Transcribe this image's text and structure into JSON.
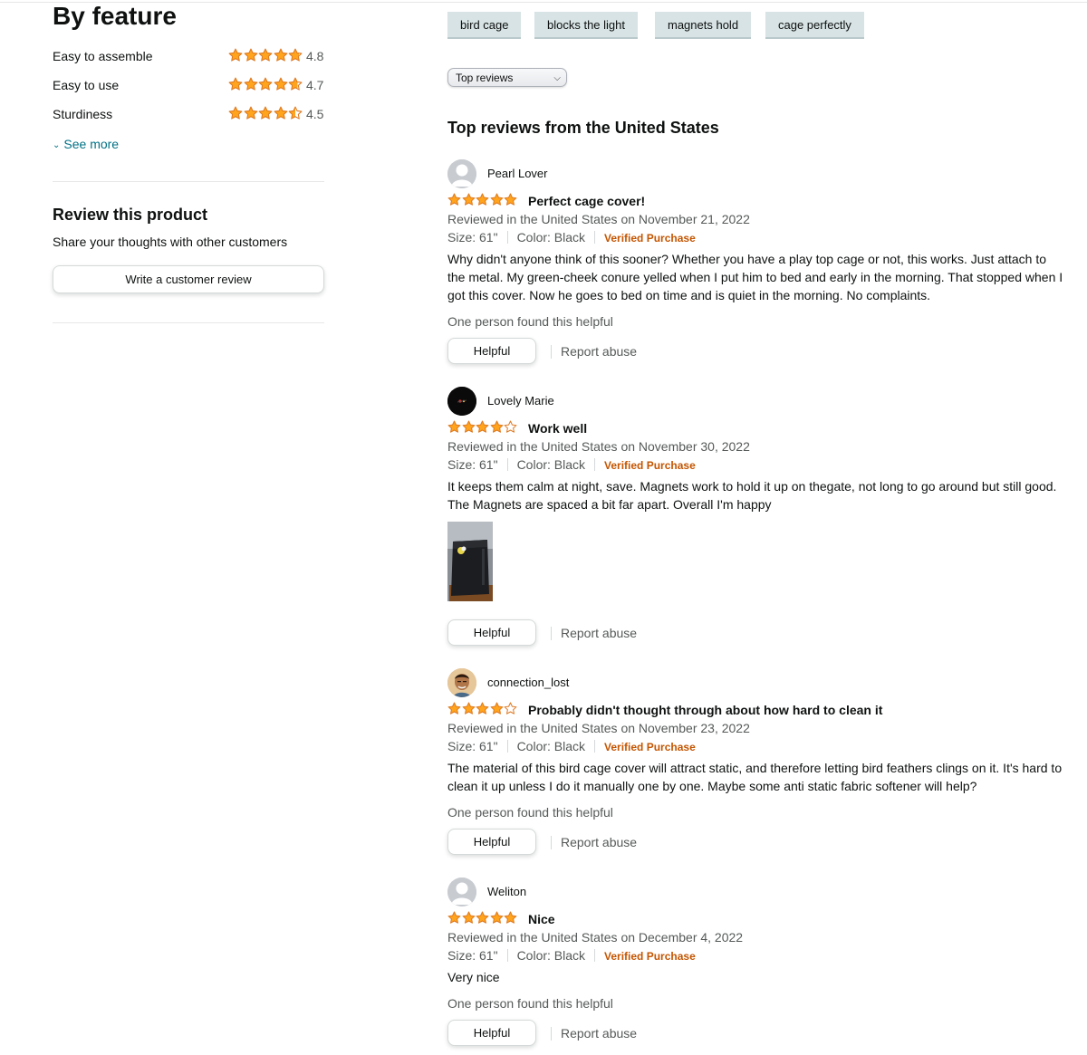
{
  "colors": {
    "star": "#ffa41c",
    "star_outline": "#de7921",
    "link": "#007185",
    "verified": "#c45500",
    "tag_bg": "#d7e3e4",
    "muted": "#565959"
  },
  "by_feature": {
    "title": "By feature",
    "items": [
      {
        "label": "Easy to assemble",
        "rating": 4.8,
        "rating_text": "4.8"
      },
      {
        "label": "Easy to use",
        "rating": 4.7,
        "rating_text": "4.7"
      },
      {
        "label": "Sturdiness",
        "rating": 4.5,
        "rating_text": "4.5"
      }
    ],
    "see_more": "See more"
  },
  "review_product": {
    "title": "Review this product",
    "subtitle": "Share your thoughts with other customers",
    "button": "Write a customer review"
  },
  "tags": [
    "bird cage",
    "blocks the light",
    "magnets hold",
    "cage perfectly"
  ],
  "sort": {
    "selected": "Top reviews"
  },
  "section_title": "Top reviews from the United States",
  "reviews": [
    {
      "name": "Pearl Lover",
      "avatar": "default-avatar-icon",
      "rating": 5,
      "title": "Perfect cage cover!",
      "date": "Reviewed in the United States on November 21, 2022",
      "size": "Size: 61\"",
      "color": "Color: Black",
      "verified": "Verified Purchase",
      "body": "Why didn't anyone think of this sooner? Whether you have a play top cage or not, this works. Just attach to the metal. My green-cheek conure yelled when I put him to bed and early in the morning. That stopped when I got this cover. Now he goes to bed on time and is quiet in the morning. No complaints.",
      "helpful_text": "One person found this helpful",
      "helpful_button": "Helpful",
      "report": "Report abuse"
    },
    {
      "name": "Lovely Marie",
      "avatar": "dark-profile-avatar",
      "rating": 4,
      "title": "Work well",
      "date": "Reviewed in the United States on November 30, 2022",
      "size": "Size: 61\"",
      "color": "Color: Black",
      "verified": "Verified Purchase",
      "body": "It keeps them calm at night, save. Magnets work to hold it up on thegate, not long to go around but still good. The Magnets are spaced a bit far apart. Overall I'm happy",
      "helpful_button": "Helpful",
      "report": "Report abuse"
    },
    {
      "name": "connection_lost",
      "avatar": "photo-profile-avatar",
      "rating": 4,
      "title": "Probably didn't thought through about how hard to clean it",
      "date": "Reviewed in the United States on November 23, 2022",
      "size": "Size: 61\"",
      "color": "Color: Black",
      "verified": "Verified Purchase",
      "body": "The material of this bird cage cover will attract static, and therefore letting bird feathers clings on it. It's hard to clean it up unless I do it manually one by one. Maybe some anti static fabric softener will help?",
      "helpful_text": "One person found this helpful",
      "helpful_button": "Helpful",
      "report": "Report abuse"
    },
    {
      "name": "Weliton",
      "avatar": "default-avatar-icon",
      "rating": 5,
      "title": "Nice",
      "date": "Reviewed in the United States on December 4, 2022",
      "size": "Size: 61\"",
      "color": "Color: Black",
      "verified": "Verified Purchase",
      "body": "Very nice",
      "helpful_text": "One person found this helpful",
      "helpful_button": "Helpful",
      "report": "Report abuse"
    }
  ]
}
